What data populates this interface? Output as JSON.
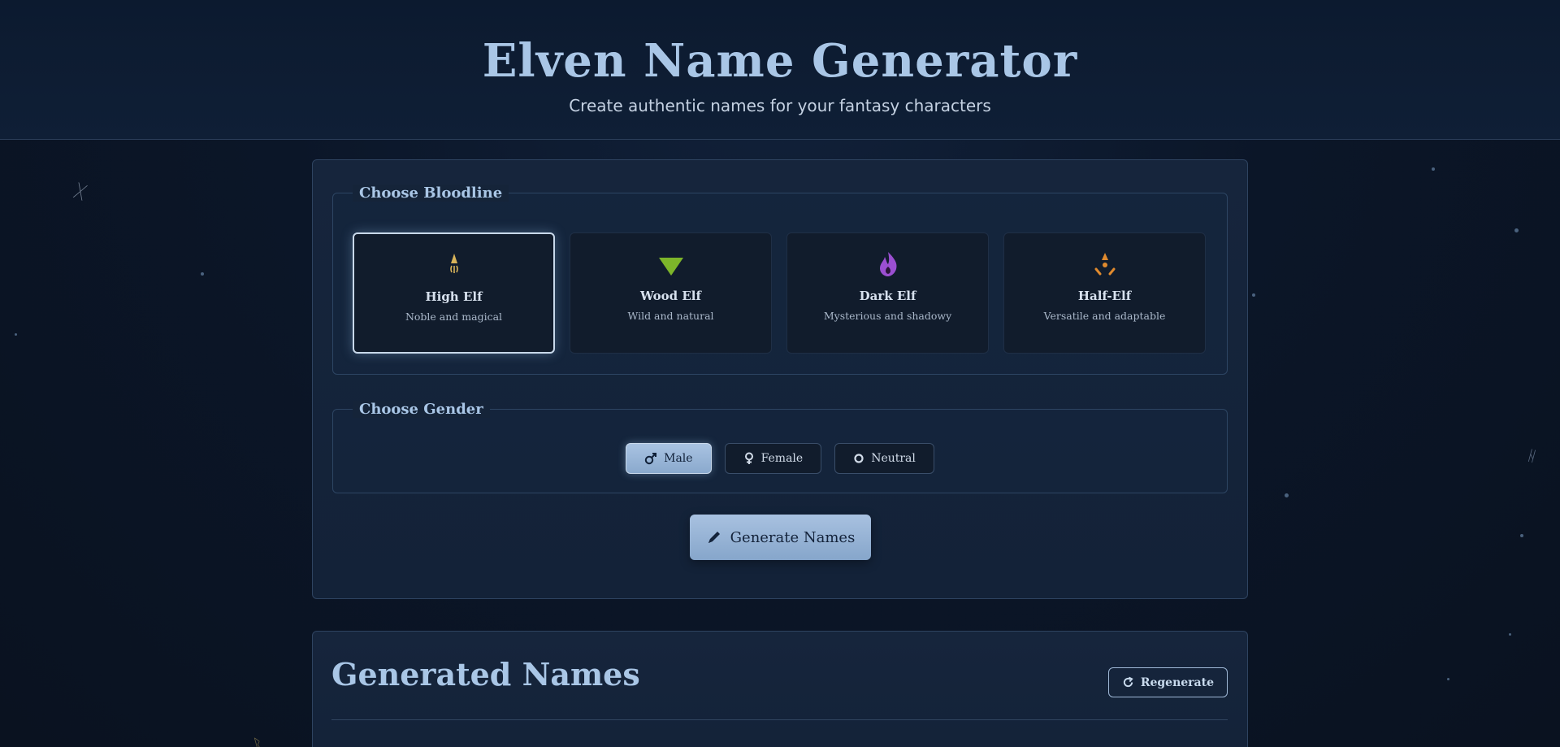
{
  "header": {
    "title": "Elven Name Generator",
    "subtitle": "Create authentic names for your fantasy characters"
  },
  "bloodline": {
    "legend": "Choose Bloodline",
    "options": [
      {
        "name": "High Elf",
        "description": "Noble and magical",
        "icon": "spire-icon",
        "selected": true,
        "color": "#d9b45a"
      },
      {
        "name": "Wood Elf",
        "description": "Wild and natural",
        "icon": "leaf-triangle-icon",
        "selected": false,
        "color": "#7db52a"
      },
      {
        "name": "Dark Elf",
        "description": "Mysterious and shadowy",
        "icon": "flame-icon",
        "selected": false,
        "color": "#9b4fd1"
      },
      {
        "name": "Half-Elf",
        "description": "Versatile and adaptable",
        "icon": "balance-icon",
        "selected": false,
        "color": "#e08a2e"
      }
    ]
  },
  "gender": {
    "legend": "Choose Gender",
    "options": [
      {
        "label": "Male",
        "icon": "mars-icon",
        "selected": true
      },
      {
        "label": "Female",
        "icon": "venus-icon",
        "selected": false
      },
      {
        "label": "Neutral",
        "icon": "circle-icon",
        "selected": false
      }
    ]
  },
  "actions": {
    "generate_label": "Generate Names",
    "regenerate_label": "Regenerate"
  },
  "results": {
    "title": "Generated Names"
  },
  "colors": {
    "accent": "#a9c6e6",
    "background": "#0b1628",
    "button": "#98b5d7"
  }
}
